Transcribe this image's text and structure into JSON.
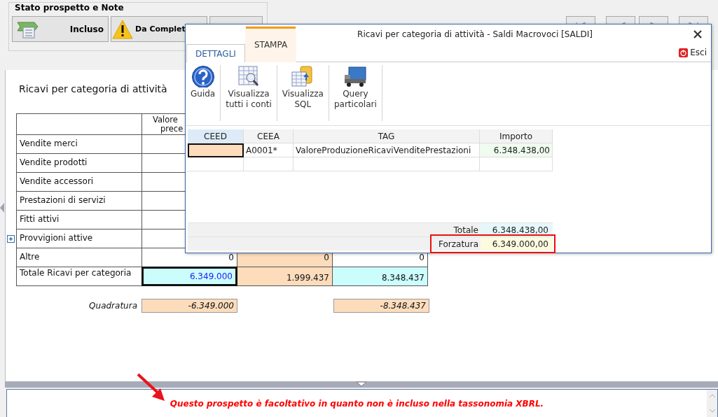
{
  "status_group": {
    "title": "Stato prospetto e Note",
    "buttons": [
      {
        "kind": "included",
        "label": "Incluso"
      },
      {
        "kind": "warning",
        "label": "Da Complet"
      },
      {
        "kind": "covered"
      }
    ]
  },
  "report": {
    "title": "Ricavi per categoria di attività",
    "header_lines": [
      "Valore",
      "prece"
    ],
    "rows": [
      {
        "label": "Vendite merci",
        "expandable": false
      },
      {
        "label": "Vendite prodotti",
        "expandable": false
      },
      {
        "label": "Vendite accessori",
        "expandable": false
      },
      {
        "label": "Prestazioni di servizi",
        "expandable": false
      },
      {
        "label": "Fitti attivi",
        "expandable": false
      },
      {
        "label": "Provvigioni attive",
        "expandable": true
      },
      {
        "label": "Altre",
        "expandable": false,
        "cells": [
          {
            "kind": "plain",
            "value": "0",
            "selected": false
          },
          {
            "kind": "input",
            "value": "0",
            "selected": false
          },
          {
            "kind": "plain",
            "value": "0",
            "selected": false
          }
        ]
      },
      {
        "label": "Totale Ricavi per categoria",
        "expandable": false,
        "cells": [
          {
            "kind": "total",
            "value": "6.349.000",
            "selected": true
          },
          {
            "kind": "input",
            "value": "1.999.437",
            "selected": false
          },
          {
            "kind": "total",
            "value": "8.348.437",
            "selected": false
          }
        ]
      }
    ],
    "check": {
      "label": "Quadratura",
      "cells": [
        {
          "kind": "value",
          "value": "-6.349.000"
        },
        {
          "kind": "empty"
        },
        {
          "kind": "value",
          "value": "-8.348.437"
        }
      ]
    }
  },
  "dialog": {
    "title": "Ricavi per categoria di attività - Saldi Macrovoci [SALDI]",
    "tabs": [
      {
        "label": "DETTAGLI",
        "selected": true
      },
      {
        "label": "STAMPA",
        "selected": false
      }
    ],
    "exit_label": "Esci",
    "toolbar": [
      {
        "kind": "help",
        "label": "Guida"
      },
      {
        "kind": "accounts",
        "label": "Visualizza\ntutti i conti"
      },
      {
        "kind": "sql",
        "label": "Visualizza\nSQL"
      },
      {
        "kind": "query",
        "label": "Query\nparticolari"
      }
    ],
    "grid": {
      "columns": [
        {
          "label": "CEED",
          "selected": true
        },
        {
          "label": "CEEA",
          "selected": false
        },
        {
          "label": "TAG",
          "selected": false
        },
        {
          "label": "Importo",
          "selected": false
        }
      ],
      "rows": [
        {
          "cells": [
            {
              "kind": "input",
              "selected": true
            },
            {
              "kind": "plain",
              "value": "A0001*",
              "selected": false
            },
            {
              "kind": "plain",
              "value": "ValoreProduzioneRicaviVenditePrestazioni",
              "selected": false
            },
            {
              "kind": "amount",
              "value": "6.348.438,00",
              "selected": false
            }
          ]
        },
        {
          "cells": [
            {
              "kind": "plain",
              "selected": false
            },
            {
              "kind": "plain",
              "selected": false
            },
            {
              "kind": "plain",
              "selected": false
            },
            {
              "kind": "plain",
              "selected": false
            }
          ]
        }
      ],
      "totals": [
        {
          "kind": "total",
          "label": "Totale",
          "value": "6.348.438,00",
          "highlighted": false
        },
        {
          "kind": "override",
          "label": "Forzatura",
          "value": "6.349.000,00",
          "highlighted": true
        }
      ]
    }
  },
  "note": {
    "text": "Questo prospetto è facoltativo in quanto non è incluso nella tassonomia XBRL."
  }
}
